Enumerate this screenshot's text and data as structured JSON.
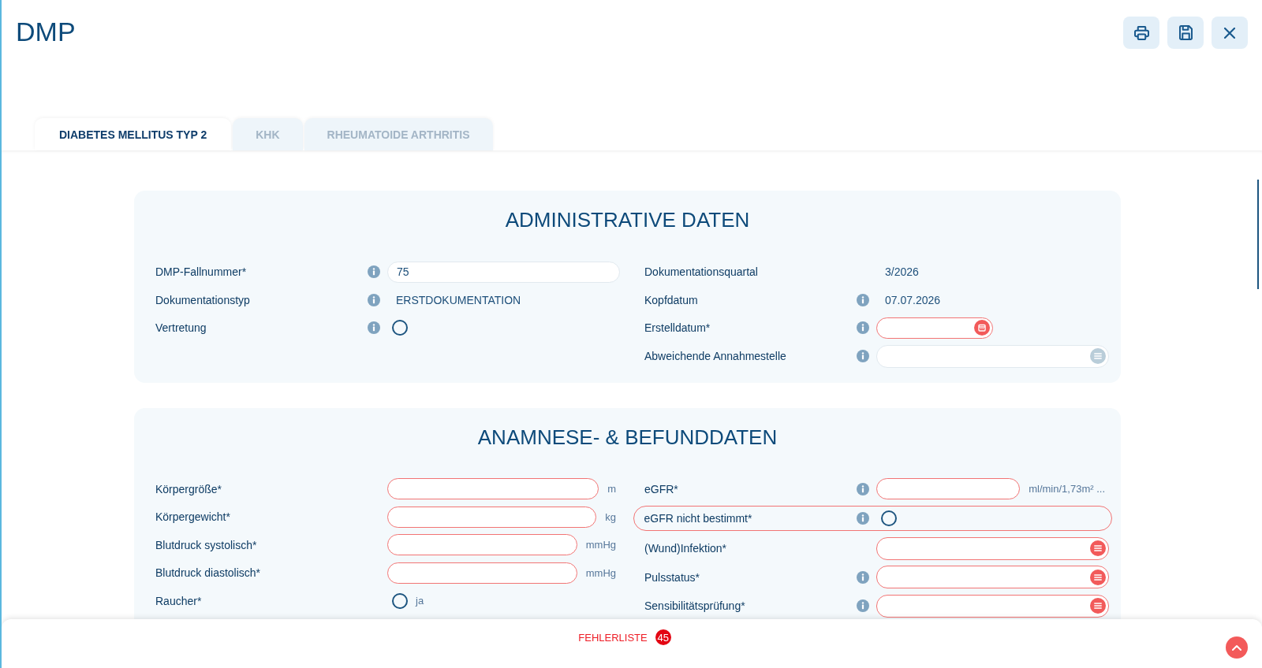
{
  "header": {
    "title": "DMP",
    "actions": [
      {
        "kind": "print"
      },
      {
        "kind": "save"
      },
      {
        "kind": "close"
      }
    ]
  },
  "tabs": [
    {
      "label": "DIABETES MELLITUS TYP 2",
      "selected": true
    },
    {
      "label": "KHK",
      "selected": false
    },
    {
      "label": "RHEUMATOIDE ARTHRITIS",
      "selected": false
    }
  ],
  "sections": [
    {
      "title": "ADMINISTRATIVE DATEN",
      "columns": [
        [
          {
            "label": "DMP-Fallnummer*",
            "info": true,
            "kind": "input",
            "value": "75",
            "error": false
          },
          {
            "label": "Dokumentationstyp",
            "info": true,
            "kind": "static",
            "value": "ERSTDOKUMENTATION"
          },
          {
            "label": "Vertretung",
            "info": true,
            "kind": "radio",
            "checked": false,
            "error": false
          }
        ],
        [
          {
            "label": "Dokumentationsquartal",
            "info": false,
            "kind": "static",
            "value": "3/2026"
          },
          {
            "label": "Kopfdatum",
            "info": true,
            "kind": "static",
            "value": "07.07.2026"
          },
          {
            "label": "Erstelldatum*",
            "info": true,
            "kind": "date",
            "error": true
          },
          {
            "label": "Abweichende Annahmestelle",
            "info": true,
            "kind": "select",
            "error": false
          }
        ]
      ]
    },
    {
      "title": "ANAMNESE- & BEFUNDDATEN",
      "columns": [
        [
          {
            "label": "Körpergröße*",
            "info": false,
            "kind": "input",
            "error": true,
            "unit": "m"
          },
          {
            "label": "Körpergewicht*",
            "info": false,
            "kind": "input",
            "error": true,
            "unit": "kg"
          },
          {
            "label": "Blutdruck systolisch*",
            "info": false,
            "kind": "input",
            "error": true,
            "unit": "mmHg"
          },
          {
            "label": "Blutdruck diastolisch*",
            "info": false,
            "kind": "input",
            "error": true,
            "unit": "mmHg"
          },
          {
            "label": "Raucher*",
            "info": false,
            "kind": "radio",
            "checked": false,
            "error": false,
            "option": "ja"
          }
        ],
        [
          {
            "label": "eGFR*",
            "info": true,
            "kind": "input",
            "error": true,
            "unit": "ml/min/1,73m² ..."
          },
          {
            "label": "eGFR nicht bestimmt*",
            "info": true,
            "kind": "radio",
            "checked": false,
            "error": true
          },
          {
            "label": "(Wund)Infektion*",
            "info": false,
            "kind": "select",
            "error": true
          },
          {
            "label": "Pulsstatus*",
            "info": true,
            "kind": "select",
            "error": true
          },
          {
            "label": "Sensibilitätsprüfung*",
            "info": true,
            "kind": "select",
            "error": true
          }
        ]
      ]
    }
  ],
  "footer": {
    "error_list": {
      "label": "FEHLERLISTE",
      "count": "45"
    }
  }
}
